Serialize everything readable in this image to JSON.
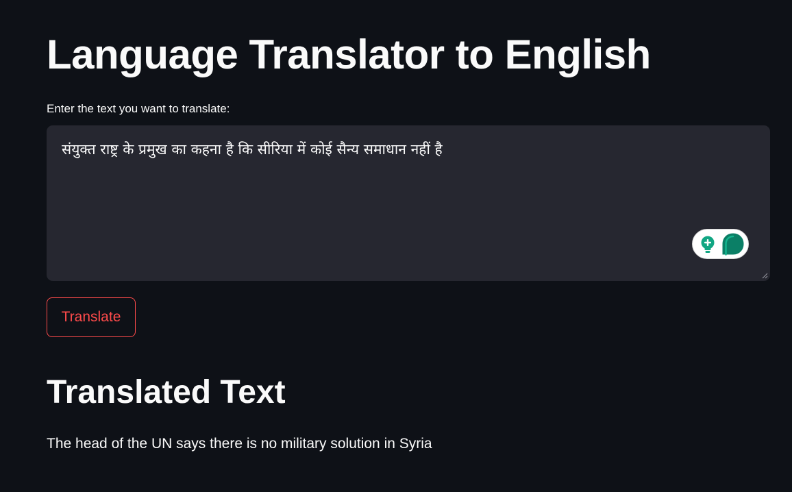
{
  "page": {
    "title": "Language Translator to English"
  },
  "input": {
    "label": "Enter the text you want to translate:",
    "value": "संयुक्त राष्ट्र के प्रमुख का कहना है कि सीरिया में कोई सैन्य समाधान नहीं है"
  },
  "grammarly": {
    "icons": [
      "lightbulb-plus-icon",
      "grammarly-logo-icon"
    ],
    "color": "#11a683"
  },
  "actions": {
    "translate_label": "Translate"
  },
  "output": {
    "heading": "Translated Text",
    "text": "The head of the UN says there is no military solution in Syria"
  },
  "colors": {
    "background": "#0e1117",
    "input_background": "#262730",
    "accent": "#ff4b4b",
    "text": "#fafafa"
  }
}
